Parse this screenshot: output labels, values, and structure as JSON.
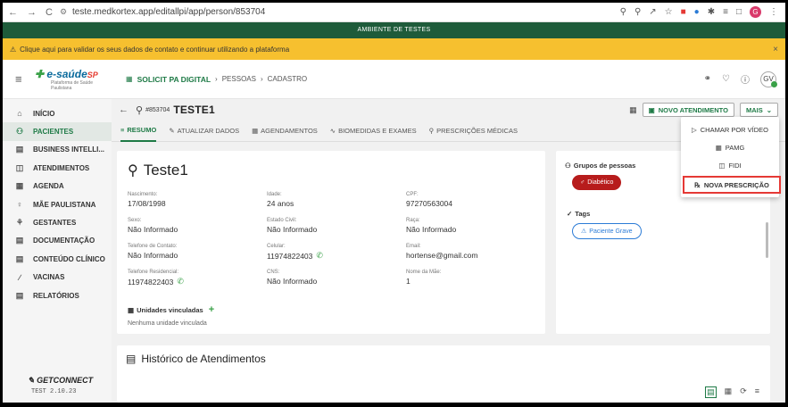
{
  "browser": {
    "url": "teste.medkortex.app/editallpi/app/person/853704",
    "profile_initial": "G"
  },
  "env_banner": "AMBIENTE DE TESTES",
  "warning": {
    "text": "Clique aqui para validar os seus dados de contato e continuar utilizando a plataforma"
  },
  "header": {
    "logo_text": "e-saúde",
    "logo_suffix": "SP",
    "logo_sub": "Plataforma de Saúde Paulistana",
    "app_name": "SOLICIT PA DIGITAL",
    "crumb1": "PESSOAS",
    "crumb2": "CADASTRO",
    "user_initials": "GV"
  },
  "sidebar": {
    "items": [
      {
        "label": "INÍCIO"
      },
      {
        "label": "PACIENTES"
      },
      {
        "label": "BUSINESS INTELLI..."
      },
      {
        "label": "ATENDIMENTOS"
      },
      {
        "label": "AGENDA"
      },
      {
        "label": "MÃE PAULISTANA"
      },
      {
        "label": "GESTANTES"
      },
      {
        "label": "DOCUMENTAÇÃO"
      },
      {
        "label": "CONTEÚDO CLÍNICO"
      },
      {
        "label": "VACINAS"
      },
      {
        "label": "RELATÓRIOS"
      }
    ],
    "brand": "GETCONNECT",
    "version": "TEST 2.10.23"
  },
  "patient": {
    "id": "#853704",
    "name_upper": "TESTE1",
    "name": "Teste1"
  },
  "toolbar": {
    "new_attendance": "NOVO ATENDIMENTO",
    "more": "MAIS"
  },
  "tabs": [
    {
      "label": "RESUMO"
    },
    {
      "label": "ATUALIZAR DADOS"
    },
    {
      "label": "AGENDAMENTOS"
    },
    {
      "label": "BIOMEDIDAS E EXAMES"
    },
    {
      "label": "PRESCRIÇÕES MÉDICAS"
    }
  ],
  "fields": {
    "nascimento": {
      "label": "Nascimento:",
      "value": "17/08/1998"
    },
    "idade": {
      "label": "Idade:",
      "value": "24 anos"
    },
    "cpf": {
      "label": "CPF:",
      "value": "97270563004"
    },
    "sexo": {
      "label": "Sexo:",
      "value": "Não Informado"
    },
    "estado_civil": {
      "label": "Estado Civil:",
      "value": "Não Informado"
    },
    "raca": {
      "label": "Raça:",
      "value": "Não Informado"
    },
    "tel_contato": {
      "label": "Telefone de Contato:",
      "value": "Não Informado"
    },
    "celular": {
      "label": "Celular:",
      "value": "11974822403"
    },
    "email": {
      "label": "Email:",
      "value": "hortense@gmail.com"
    },
    "tel_residencial": {
      "label": "Telefone Residencial:",
      "value": "11974822403"
    },
    "cns": {
      "label": "CNS:",
      "value": "Não Informado"
    },
    "mae": {
      "label": "Nome da Mãe:",
      "value": "1"
    }
  },
  "unidades": {
    "title": "Unidades vinculadas",
    "empty": "Nenhuma unidade vinculada"
  },
  "groups": {
    "title": "Grupos de pessoas",
    "chip": "Diabético"
  },
  "tags": {
    "title": "Tags",
    "chip": "Paciente Grave"
  },
  "history": {
    "title": "Histórico de Atendimentos"
  },
  "dropdown": {
    "items": [
      {
        "label": "CHAMAR POR VÍDEO"
      },
      {
        "label": "PAMG"
      },
      {
        "label": "FIDI"
      },
      {
        "label": "NOVA PRESCRIÇÃO"
      }
    ]
  },
  "colors": {
    "primary": "#1e7a46",
    "warning": "#f6c02f",
    "env": "#1e5b3a",
    "danger_chip": "#b71c1c",
    "tag_chip": "#2b7bd6",
    "highlight": "#e53935"
  }
}
